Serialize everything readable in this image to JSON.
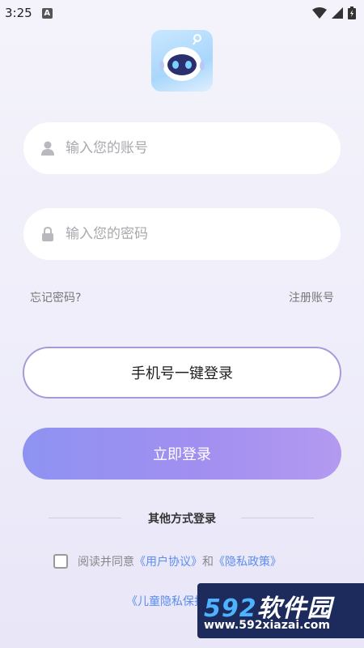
{
  "status": {
    "time": "3:25",
    "notif": "A"
  },
  "login": {
    "account_placeholder": "输入您的账号",
    "password_placeholder": "输入您的密码",
    "forgot": "忘记密码?",
    "register": "注册账号",
    "phone_login": "手机号一键登录",
    "login_now": "立即登录",
    "other_methods": "其他方式登录"
  },
  "agreement": {
    "prefix": "阅读并同意",
    "user_agreement": "《用户协议》",
    "and": "和",
    "privacy": "《隐私政策》",
    "child_privacy": "《儿童隐私保护",
    "checked": false
  },
  "watermark": {
    "num": "592",
    "cn": "软件园",
    "url": "www.592xiazai.com"
  },
  "colors": {
    "accent_start": "#8e93f2",
    "accent_end": "#b39af0",
    "link": "#5b8def",
    "phone_border": "#a89ad8"
  }
}
